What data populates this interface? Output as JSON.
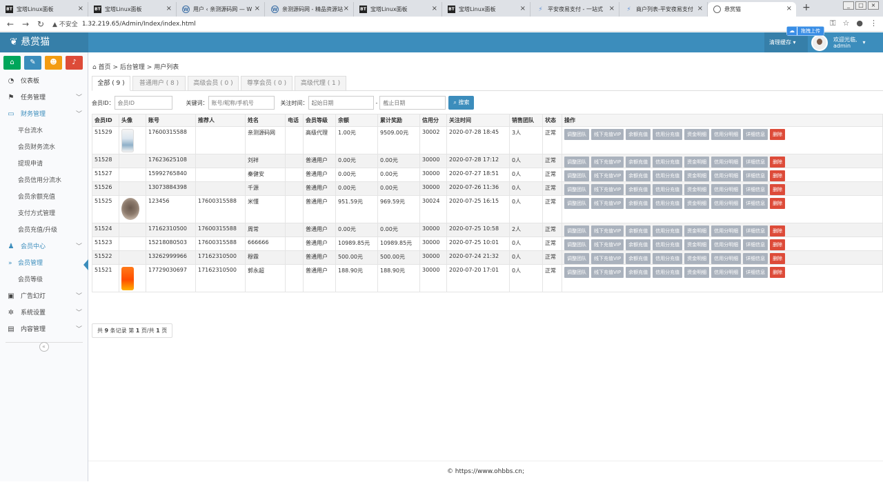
{
  "browser": {
    "tabs": [
      {
        "icon": "bt",
        "title": "宝塔Linux面板"
      },
      {
        "icon": "bt",
        "title": "宝塔Linux面板"
      },
      {
        "icon": "wp",
        "title": "用户 ‹ 亲测源码网 — W"
      },
      {
        "icon": "wp",
        "title": "亲测源码网 - 精品资源站"
      },
      {
        "icon": "bt",
        "title": "宝塔Linux面板"
      },
      {
        "icon": "bt",
        "title": "宝塔Linux面板"
      },
      {
        "icon": "pay",
        "title": "平安夜易支付 - 一站式"
      },
      {
        "icon": "pay",
        "title": "商户列表-平安夜易支付"
      },
      {
        "icon": "globe",
        "title": "悬赏猫"
      }
    ],
    "insecure_label": "不安全",
    "url": "1.32.219.65/Admin/Index/index.html",
    "upload_label": "拖拽上传"
  },
  "header": {
    "logo": "悬赏猫",
    "clear_cache": "清理缓存",
    "welcome": "欢迎光临,",
    "username": "admin"
  },
  "sidebar": {
    "quick_colors": [
      "#00a65a",
      "#3c8dbc",
      "#f39c12",
      "#dd4b39"
    ],
    "dashboard": "仪表板",
    "task_mgmt": "任务管理",
    "finance": "财务管理",
    "finance_items": [
      "平台流水",
      "会员财务流水",
      "提现申请",
      "会员信用分流水",
      "会员余额充值",
      "支付方式管理",
      "会员充值/升级"
    ],
    "member_center": "会员中心",
    "member_items": [
      "会员管理",
      "会员等级"
    ],
    "ads": "广告幻灯",
    "settings": "系统设置",
    "content": "内容管理",
    "collapse": "«"
  },
  "breadcrumb": {
    "home": "首页",
    "sep1": ">",
    "admin": "后台管理",
    "sep2": ">",
    "current": "用户列表"
  },
  "filter_tabs": [
    "全部 ( 9 )",
    "普通用户 ( 8 )",
    "高级会员 ( 0 )",
    "尊享会员 ( 0 )",
    "高级代理 ( 1 )"
  ],
  "filter": {
    "member_id_label": "会员ID：",
    "member_id_placeholder": "会员ID",
    "keyword_label": "关键词：",
    "keyword_placeholder": "账号/昵称/手机号",
    "time_label": "关注时间：",
    "start_placeholder": "起始日期",
    "dash": "-",
    "end_placeholder": "截止日期",
    "search": "搜索"
  },
  "table": {
    "headers": [
      "会员ID",
      "头像",
      "账号",
      "推荐人",
      "姓名",
      "电话",
      "会员等级",
      "余额",
      "累计奖励",
      "信用分",
      "关注时间",
      "销售团队",
      "状态",
      "操作"
    ],
    "actions": [
      "调整团队",
      "线下充值VIP",
      "余额充值",
      "信用分充值",
      "资金明细",
      "信用分明细",
      "详细信息",
      "删除"
    ],
    "rows": [
      {
        "id": "51529",
        "avatar": "a1",
        "account": "17600315588",
        "referrer": "",
        "name": "亲测源码网",
        "phone": "",
        "level": "高级代理",
        "balance": "1.00元",
        "reward": "9509.00元",
        "credit": "30002",
        "time": "2020-07-28 18:45",
        "team": "3人",
        "status": "正常"
      },
      {
        "id": "51528",
        "avatar": "",
        "account": "17623625108",
        "referrer": "",
        "name": "刘祥",
        "phone": "",
        "level": "普通用户",
        "balance": "0.00元",
        "reward": "0.00元",
        "credit": "30000",
        "time": "2020-07-28 17:12",
        "team": "0人",
        "status": "正常"
      },
      {
        "id": "51527",
        "avatar": "",
        "account": "15992765840",
        "referrer": "",
        "name": "秦健安",
        "phone": "",
        "level": "普通用户",
        "balance": "0.00元",
        "reward": "0.00元",
        "credit": "30000",
        "time": "2020-07-27 18:51",
        "team": "0人",
        "status": "正常"
      },
      {
        "id": "51526",
        "avatar": "",
        "account": "13073884398",
        "referrer": "",
        "name": "千源",
        "phone": "",
        "level": "普通用户",
        "balance": "0.00元",
        "reward": "0.00元",
        "credit": "30000",
        "time": "2020-07-26 11:36",
        "team": "0人",
        "status": "正常"
      },
      {
        "id": "51525",
        "avatar": "a2",
        "account": "123456",
        "referrer": "17600315588",
        "name": "米懂",
        "phone": "",
        "level": "普通用户",
        "balance": "951.59元",
        "reward": "969.59元",
        "credit": "30024",
        "time": "2020-07-25 16:15",
        "team": "0人",
        "status": "正常"
      },
      {
        "id": "51524",
        "avatar": "",
        "account": "17162310500",
        "referrer": "17600315588",
        "name": "周常",
        "phone": "",
        "level": "普通用户",
        "balance": "0.00元",
        "reward": "0.00元",
        "credit": "30000",
        "time": "2020-07-25 10:58",
        "team": "2人",
        "status": "正常"
      },
      {
        "id": "51523",
        "avatar": "",
        "account": "15218080503",
        "referrer": "17600315588",
        "name": "666666",
        "phone": "",
        "level": "普通用户",
        "balance": "10989.85元",
        "reward": "10989.85元",
        "credit": "30000",
        "time": "2020-07-25 10:01",
        "team": "0人",
        "status": "正常"
      },
      {
        "id": "51522",
        "avatar": "",
        "account": "13262999966",
        "referrer": "17162310500",
        "name": "穆霖",
        "phone": "",
        "level": "普通用户",
        "balance": "500.00元",
        "reward": "500.00元",
        "credit": "30000",
        "time": "2020-07-24 21:32",
        "team": "0人",
        "status": "正常"
      },
      {
        "id": "51521",
        "avatar": "a3",
        "account": "17729030697",
        "referrer": "17162310500",
        "name": "郭永超",
        "phone": "",
        "level": "普通用户",
        "balance": "188.90元",
        "reward": "188.90元",
        "credit": "30000",
        "time": "2020-07-20 17:01",
        "team": "0人",
        "status": "正常"
      }
    ]
  },
  "pager": {
    "prefix": "共",
    "total": "9",
    "mid": "条记录 第",
    "page": "1",
    "mid2": "页/共",
    "pages": "1",
    "suffix": "页"
  },
  "footer": "© https://www.ohbbs.cn;"
}
